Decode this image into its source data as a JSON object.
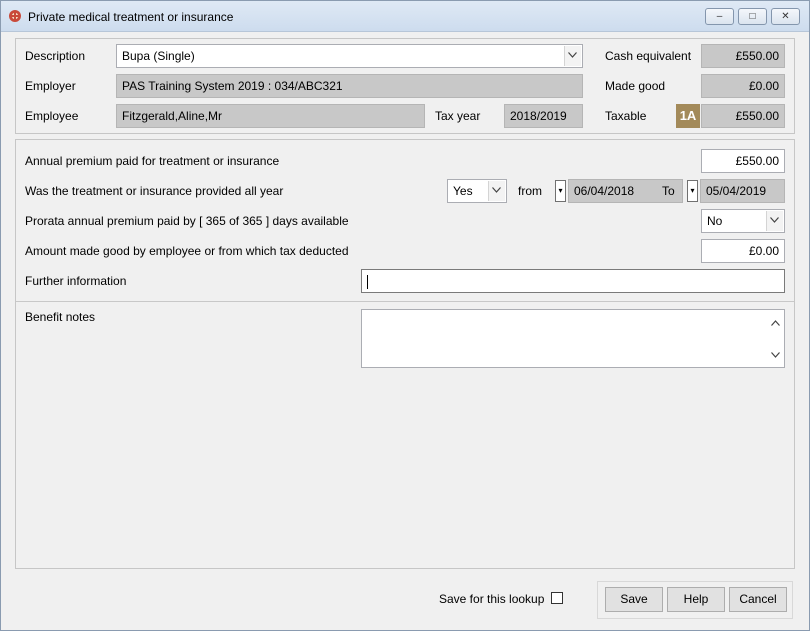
{
  "window": {
    "title": "Private medical treatment or insurance",
    "minimize": "–",
    "maximize": "□",
    "close": "✕"
  },
  "header": {
    "description_label": "Description",
    "description_value": "Bupa (Single)",
    "employer_label": "Employer",
    "employer_value": "PAS Training System 2019 : 034/ABC321",
    "employee_label": "Employee",
    "employee_value": "Fitzgerald,Aline,Mr",
    "tax_year_label": "Tax year",
    "tax_year_value": "2018/2019",
    "cash_equivalent_label": "Cash equivalent",
    "cash_equivalent_value": "£550.00",
    "made_good_label": "Made good",
    "made_good_value": "£0.00",
    "taxable_label": "Taxable",
    "taxable_badge": "1A",
    "taxable_value": "£550.00"
  },
  "details": {
    "annual_premium_label": "Annual premium paid for treatment or insurance",
    "annual_premium_value": "£550.00",
    "all_year_label": "Was the treatment or insurance provided all year",
    "all_year_value": "Yes",
    "from_label": "from",
    "from_date": "06/04/2018",
    "to_label": "To",
    "to_date": "05/04/2019",
    "prorata_label": "Prorata annual premium paid by [ 365 of 365 ] days available",
    "prorata_value": "No",
    "made_good_label": "Amount made good by employee or from which tax deducted",
    "made_good_value": "£0.00",
    "further_info_label": "Further information",
    "further_info_value": ""
  },
  "notes": {
    "label": "Benefit notes",
    "value": ""
  },
  "footer": {
    "save_lookup_label": "Save for this lookup",
    "save_lookup_checked": false,
    "save_label": "Save",
    "help_label": "Help",
    "cancel_label": "Cancel"
  }
}
